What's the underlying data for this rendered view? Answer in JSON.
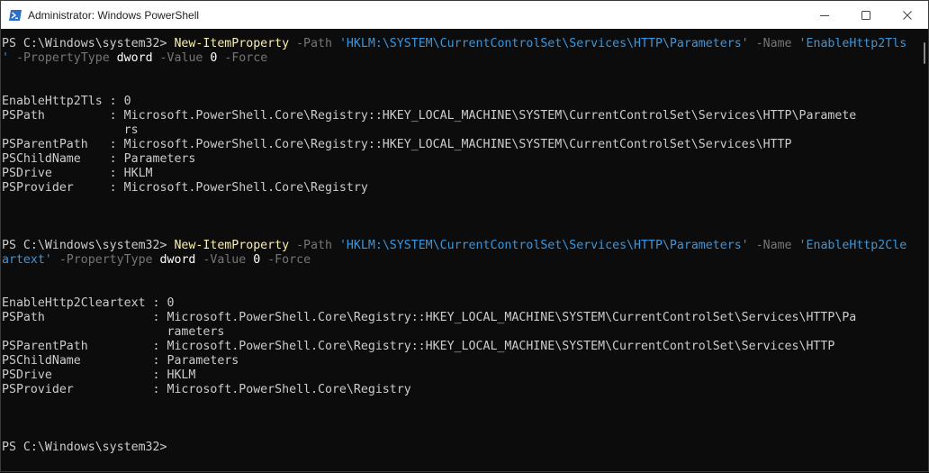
{
  "window": {
    "title": "Administrator: Windows PowerShell"
  },
  "console": {
    "lines": [
      [
        [
          "d",
          "PS C:\\Windows\\system32> "
        ],
        [
          "y",
          "New-ItemProperty "
        ],
        [
          "g",
          "-Path "
        ],
        [
          "c",
          "'HKLM:\\SYSTEM\\CurrentControlSet\\Services\\HTTP\\Parameters' "
        ],
        [
          "g",
          "-Name "
        ],
        [
          "c",
          "'EnableHttp2Tls"
        ]
      ],
      [
        [
          "c",
          "' "
        ],
        [
          "g",
          "-PropertyType "
        ],
        [
          "w",
          "dword "
        ],
        [
          "g",
          "-Value "
        ],
        [
          "w",
          "0 "
        ],
        [
          "g",
          "-Force"
        ]
      ],
      [],
      [],
      [
        [
          "d",
          "EnableHttp2Tls : 0"
        ]
      ],
      [
        [
          "d",
          "PSPath         : Microsoft.PowerShell.Core\\Registry::HKEY_LOCAL_MACHINE\\SYSTEM\\CurrentControlSet\\Services\\HTTP\\Paramete"
        ]
      ],
      [
        [
          "d",
          "                 rs"
        ]
      ],
      [
        [
          "d",
          "PSParentPath   : Microsoft.PowerShell.Core\\Registry::HKEY_LOCAL_MACHINE\\SYSTEM\\CurrentControlSet\\Services\\HTTP"
        ]
      ],
      [
        [
          "d",
          "PSChildName    : Parameters"
        ]
      ],
      [
        [
          "d",
          "PSDrive        : HKLM"
        ]
      ],
      [
        [
          "d",
          "PSProvider     : Microsoft.PowerShell.Core\\Registry"
        ]
      ],
      [],
      [],
      [],
      [
        [
          "d",
          "PS C:\\Windows\\system32> "
        ],
        [
          "y",
          "New-ItemProperty "
        ],
        [
          "g",
          "-Path "
        ],
        [
          "c",
          "'HKLM:\\SYSTEM\\CurrentControlSet\\Services\\HTTP\\Parameters' "
        ],
        [
          "g",
          "-Name "
        ],
        [
          "c",
          "'EnableHttp2Cle"
        ]
      ],
      [
        [
          "c",
          "artext' "
        ],
        [
          "g",
          "-PropertyType "
        ],
        [
          "w",
          "dword "
        ],
        [
          "g",
          "-Value "
        ],
        [
          "w",
          "0 "
        ],
        [
          "g",
          "-Force"
        ]
      ],
      [],
      [],
      [
        [
          "d",
          "EnableHttp2Cleartext : 0"
        ]
      ],
      [
        [
          "d",
          "PSPath               : Microsoft.PowerShell.Core\\Registry::HKEY_LOCAL_MACHINE\\SYSTEM\\CurrentControlSet\\Services\\HTTP\\Pa"
        ]
      ],
      [
        [
          "d",
          "                       rameters"
        ]
      ],
      [
        [
          "d",
          "PSParentPath         : Microsoft.PowerShell.Core\\Registry::HKEY_LOCAL_MACHINE\\SYSTEM\\CurrentControlSet\\Services\\HTTP"
        ]
      ],
      [
        [
          "d",
          "PSChildName          : Parameters"
        ]
      ],
      [
        [
          "d",
          "PSDrive              : HKLM"
        ]
      ],
      [
        [
          "d",
          "PSProvider           : Microsoft.PowerShell.Core\\Registry"
        ]
      ],
      [],
      [],
      [],
      [
        [
          "d",
          "PS C:\\Windows\\system32>"
        ]
      ]
    ]
  },
  "colors": {
    "background": "#0c0c0c",
    "default_text": "#cccccc",
    "command": "#f9f1a5",
    "string": "#3a96dd",
    "parameter": "#767676",
    "value": "#ffffff"
  },
  "icons": [
    "powershell-icon",
    "minimize-icon",
    "maximize-icon",
    "close-icon"
  ]
}
